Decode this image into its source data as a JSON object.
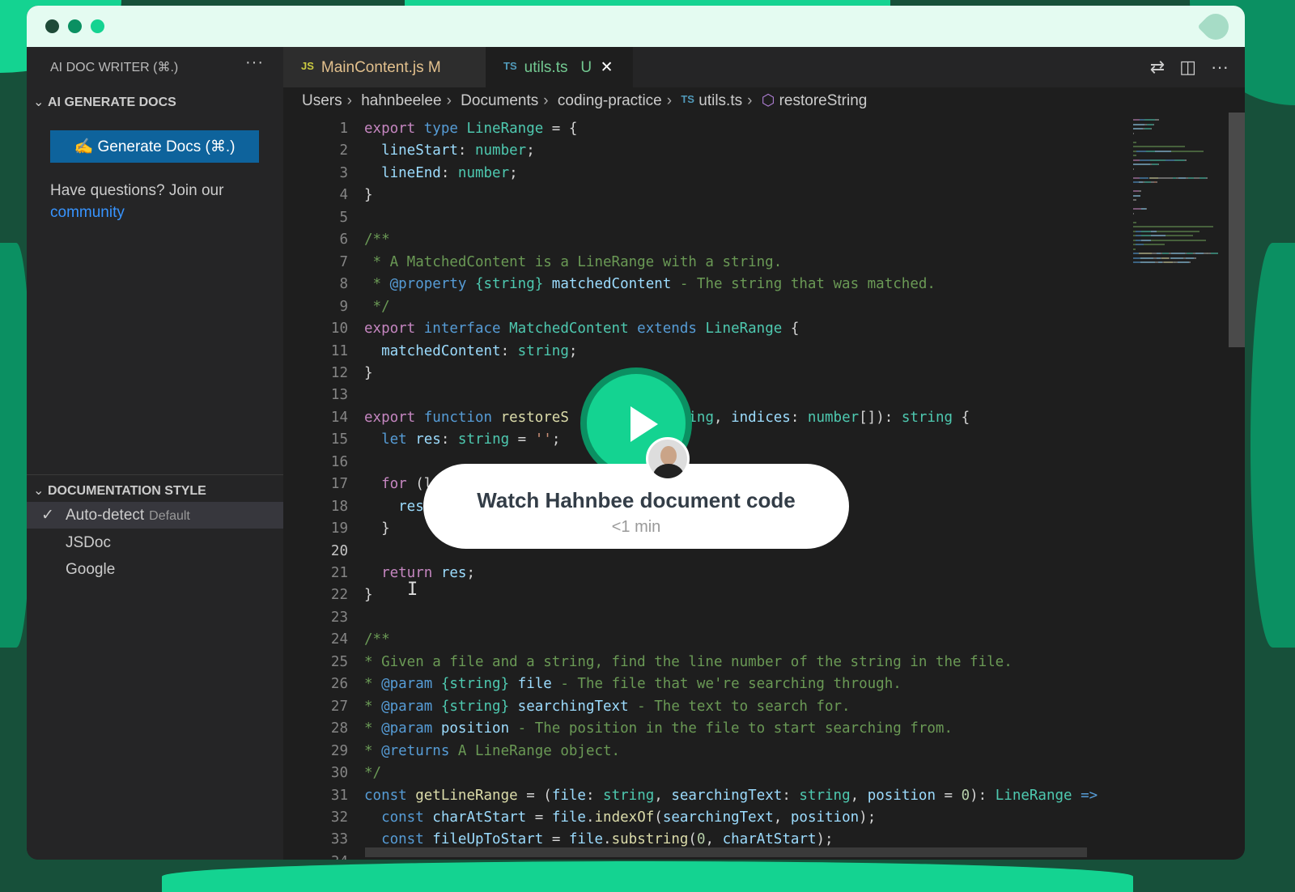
{
  "window": {
    "controls": [
      "close",
      "minimize",
      "maximize"
    ],
    "control_colors": [
      "#1e4a38",
      "#0b9062",
      "#14d391"
    ],
    "logo": "leaf-logo"
  },
  "sidebar": {
    "title": "AI DOC WRITER (⌘.)",
    "more": "···",
    "section1": "AI GENERATE DOCS",
    "generate_label": "✍ Generate Docs (⌘.)",
    "question": "Have questions? Join our",
    "community_link": "community",
    "section2": "DOCUMENTATION STYLE",
    "styles": [
      {
        "label": "Auto-detect",
        "note": "Default",
        "selected": true
      },
      {
        "label": "JSDoc"
      },
      {
        "label": "Google"
      }
    ]
  },
  "tabs": [
    {
      "type": "JS",
      "label": "MainContent.js",
      "status": "M"
    },
    {
      "type": "TS",
      "label": "utils.ts",
      "status": "U",
      "close": "✕",
      "active": true
    }
  ],
  "toolbar": {
    "compare": "⇄",
    "split": "◫",
    "more": "···"
  },
  "breadcrumb": [
    "Users",
    "hahnbeelee",
    "Documents",
    "coding-practice",
    "utils.ts",
    "restoreString"
  ],
  "breadcrumb_ts": "TS",
  "breadcrumb_symbol": "⬡",
  "current_line": 20,
  "code": [
    [
      [
        "export",
        "kw"
      ],
      [
        " type",
        "bl"
      ],
      [
        " LineRange",
        "ty"
      ],
      [
        " = {",
        "pl"
      ]
    ],
    [
      [
        "  lineStart",
        "va"
      ],
      [
        ": ",
        "pl"
      ],
      [
        "number",
        "ty"
      ],
      [
        ";",
        "pl"
      ]
    ],
    [
      [
        "  lineEnd",
        "va"
      ],
      [
        ": ",
        "pl"
      ],
      [
        "number",
        "ty"
      ],
      [
        ";",
        "pl"
      ]
    ],
    [
      [
        "}",
        "pl"
      ]
    ],
    [],
    [
      [
        "/**",
        "cm"
      ]
    ],
    [
      [
        " * A MatchedContent is a LineRange with a string.",
        "cm"
      ]
    ],
    [
      [
        " * ",
        "cm"
      ],
      [
        "@property",
        "bl"
      ],
      [
        " {string}",
        "ty"
      ],
      [
        " matchedContent",
        "va"
      ],
      [
        " - The string that was matched.",
        "cm"
      ]
    ],
    [
      [
        " */",
        "cm"
      ]
    ],
    [
      [
        "export",
        "kw"
      ],
      [
        " interface",
        "bl"
      ],
      [
        " MatchedContent",
        "ty"
      ],
      [
        " extends",
        "bl"
      ],
      [
        " LineRange",
        "ty"
      ],
      [
        " {",
        "pl"
      ]
    ],
    [
      [
        "  matchedContent",
        "va"
      ],
      [
        ": ",
        "pl"
      ],
      [
        "string",
        "ty"
      ],
      [
        ";",
        "pl"
      ]
    ],
    [
      [
        "}",
        "pl"
      ]
    ],
    [],
    [
      [
        "export",
        "kw"
      ],
      [
        " function",
        "bl"
      ],
      [
        " restoreS",
        "fn"
      ],
      [
        "              ",
        "pl"
      ],
      [
        "ing",
        "ty"
      ],
      [
        ", ",
        "pl"
      ],
      [
        "indices",
        "va"
      ],
      [
        ": ",
        "pl"
      ],
      [
        "number",
        "ty"
      ],
      [
        "[]): ",
        "pl"
      ],
      [
        "string",
        "ty"
      ],
      [
        " {",
        "pl"
      ]
    ],
    [
      [
        "  let",
        "bl"
      ],
      [
        " res",
        "va"
      ],
      [
        ": ",
        "pl"
      ],
      [
        "string",
        "ty"
      ],
      [
        " = ",
        "pl"
      ],
      [
        "''",
        "st"
      ],
      [
        ";",
        "pl"
      ]
    ],
    [],
    [
      [
        "  for",
        "kw"
      ],
      [
        " (l",
        "pl"
      ]
    ],
    [
      [
        "    res",
        "va"
      ]
    ],
    [
      [
        "  }",
        "pl"
      ]
    ],
    [],
    [
      [
        "  return",
        "kw"
      ],
      [
        " res",
        "va"
      ],
      [
        ";",
        "pl"
      ]
    ],
    [
      [
        "}",
        "pl"
      ]
    ],
    [],
    [
      [
        "/**",
        "cm"
      ]
    ],
    [
      [
        "* Given a file and a string, find the line number of the string in the file.",
        "cm"
      ]
    ],
    [
      [
        "* ",
        "cm"
      ],
      [
        "@param",
        "bl"
      ],
      [
        " {string}",
        "ty"
      ],
      [
        " file",
        "va"
      ],
      [
        " - The file that we're searching through.",
        "cm"
      ]
    ],
    [
      [
        "* ",
        "cm"
      ],
      [
        "@param",
        "bl"
      ],
      [
        " {string}",
        "ty"
      ],
      [
        " searchingText",
        "va"
      ],
      [
        " - The text to search for.",
        "cm"
      ]
    ],
    [
      [
        "* ",
        "cm"
      ],
      [
        "@param",
        "bl"
      ],
      [
        " position",
        "va"
      ],
      [
        " - The position in the file to start searching from.",
        "cm"
      ]
    ],
    [
      [
        "* ",
        "cm"
      ],
      [
        "@returns",
        "bl"
      ],
      [
        " A LineRange object.",
        "cm"
      ]
    ],
    [
      [
        "*/",
        "cm"
      ]
    ],
    [
      [
        "const",
        "bl"
      ],
      [
        " getLineRange",
        "fn"
      ],
      [
        " = (",
        "pl"
      ],
      [
        "file",
        "va"
      ],
      [
        ": ",
        "pl"
      ],
      [
        "string",
        "ty"
      ],
      [
        ", ",
        "pl"
      ],
      [
        "searchingText",
        "va"
      ],
      [
        ": ",
        "pl"
      ],
      [
        "string",
        "ty"
      ],
      [
        ", ",
        "pl"
      ],
      [
        "position",
        "va"
      ],
      [
        " = ",
        "pl"
      ],
      [
        "0",
        "nu"
      ],
      [
        "): ",
        "pl"
      ],
      [
        "LineRange",
        "ty"
      ],
      [
        " =>",
        "bl"
      ]
    ],
    [
      [
        "  const",
        "bl"
      ],
      [
        " charAtStart",
        "va"
      ],
      [
        " = ",
        "pl"
      ],
      [
        "file",
        "va"
      ],
      [
        ".",
        "pl"
      ],
      [
        "indexOf",
        "fn"
      ],
      [
        "(",
        "pl"
      ],
      [
        "searchingText",
        "va"
      ],
      [
        ", ",
        "pl"
      ],
      [
        "position",
        "va"
      ],
      [
        ");",
        "pl"
      ]
    ],
    [
      [
        "  const",
        "bl"
      ],
      [
        " fileUpToStart",
        "va"
      ],
      [
        " = ",
        "pl"
      ],
      [
        "file",
        "va"
      ],
      [
        ".",
        "pl"
      ],
      [
        "substring",
        "fn"
      ],
      [
        "(",
        "pl"
      ],
      [
        "0",
        "nu"
      ],
      [
        ", ",
        "pl"
      ],
      [
        "charAtStart",
        "va"
      ],
      [
        ");",
        "pl"
      ]
    ],
    []
  ],
  "overlay": {
    "title": "Watch Hahnbee document code",
    "duration": "<1 min",
    "play_icon": "play-icon",
    "accent": "#14d391"
  }
}
